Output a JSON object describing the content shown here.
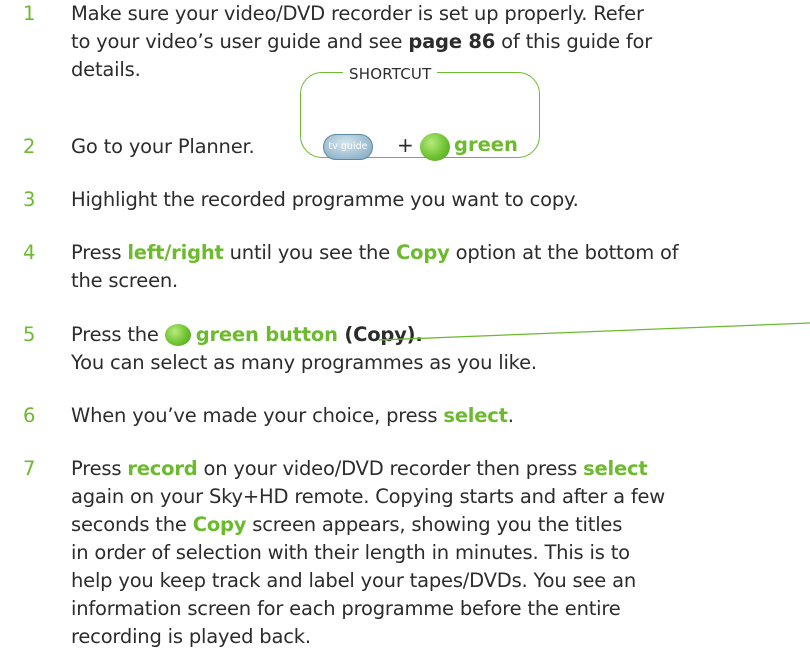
{
  "steps": [
    {
      "number": "1",
      "line1": "Make sure your video/DVD recorder is set up properly. Refer",
      "line2_a": "to your video’s user guide and see ",
      "line2_b": "page 86",
      "line2_c": " of this guide for",
      "line3": "details."
    },
    {
      "number": "2",
      "text": "Go to your Planner."
    },
    {
      "number": "3",
      "text": "Highlight the recorded programme you want to copy."
    },
    {
      "number": "4",
      "a": "Press ",
      "b": "left/right",
      "c": " until you see the ",
      "d": "Copy",
      "e": " option at the bottom of",
      "line2": "the screen."
    },
    {
      "number": "5",
      "a": "Press the ",
      "b": "green button",
      "c": " (Copy).",
      "line2": "You can select as many programmes as you like."
    },
    {
      "number": "6",
      "a": "When you’ve made your choice, press ",
      "b": "select",
      "c": "."
    },
    {
      "number": "7",
      "l1a": "Press ",
      "l1b": "record",
      "l1c": " on your video/DVD recorder then press ",
      "l1d": "select",
      "l2": "again on your Sky+HD remote. Copying starts and after a few",
      "l3a": "seconds the ",
      "l3b": "Copy",
      "l3c": " screen appears, showing you the titles",
      "l4": "in order of selection with their length in minutes. This is to",
      "l5": "help you keep track and label your tapes/DVDs. You see an",
      "l6": "information screen for each programme before the entire",
      "l7": "recording is played back."
    }
  ],
  "shortcut": {
    "label": "SHORTCUT",
    "tv_guide_label": "tv guide",
    "plus": "+",
    "green_label": "green",
    "green_icon": "green-button-icon"
  },
  "colors": {
    "accent_green": "#6cba2e",
    "text": "#2c2c2c",
    "tv_guide_blue": "#9fbfd2"
  }
}
